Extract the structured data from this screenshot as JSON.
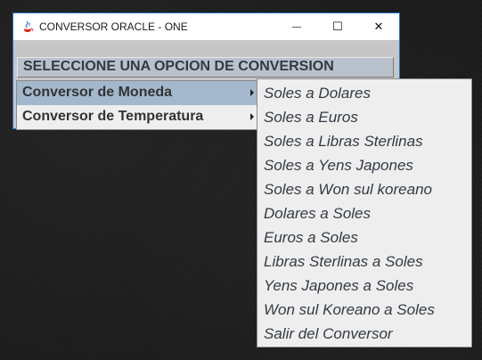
{
  "window": {
    "title": "CONVERSOR ORACLE - ONE",
    "controls": {
      "minimize": "—",
      "maximize": "☐",
      "close": "✕"
    }
  },
  "menu": {
    "header": "SELECCIONE UNA OPCION DE CONVERSION",
    "items": [
      {
        "label": "Conversor de Moneda",
        "selected": true
      },
      {
        "label": "Conversor de Temperatura",
        "selected": false
      }
    ]
  },
  "submenu": {
    "items": [
      "Soles a Dolares",
      "Soles a Euros",
      "Soles a Libras Sterlinas",
      "Soles a Yens Japones",
      "Soles a Won sul koreano",
      "Dolares a Soles",
      "Euros a Soles",
      "Libras Sterlinas a Soles",
      "Yens Japones a Soles",
      "Won sul Koreano a Soles",
      "Salir del Conversor"
    ]
  },
  "colors": {
    "titlebar_border": "#1f6fc6",
    "selected_item": "#a3b8cc",
    "menu_bg": "#eeeeee"
  }
}
